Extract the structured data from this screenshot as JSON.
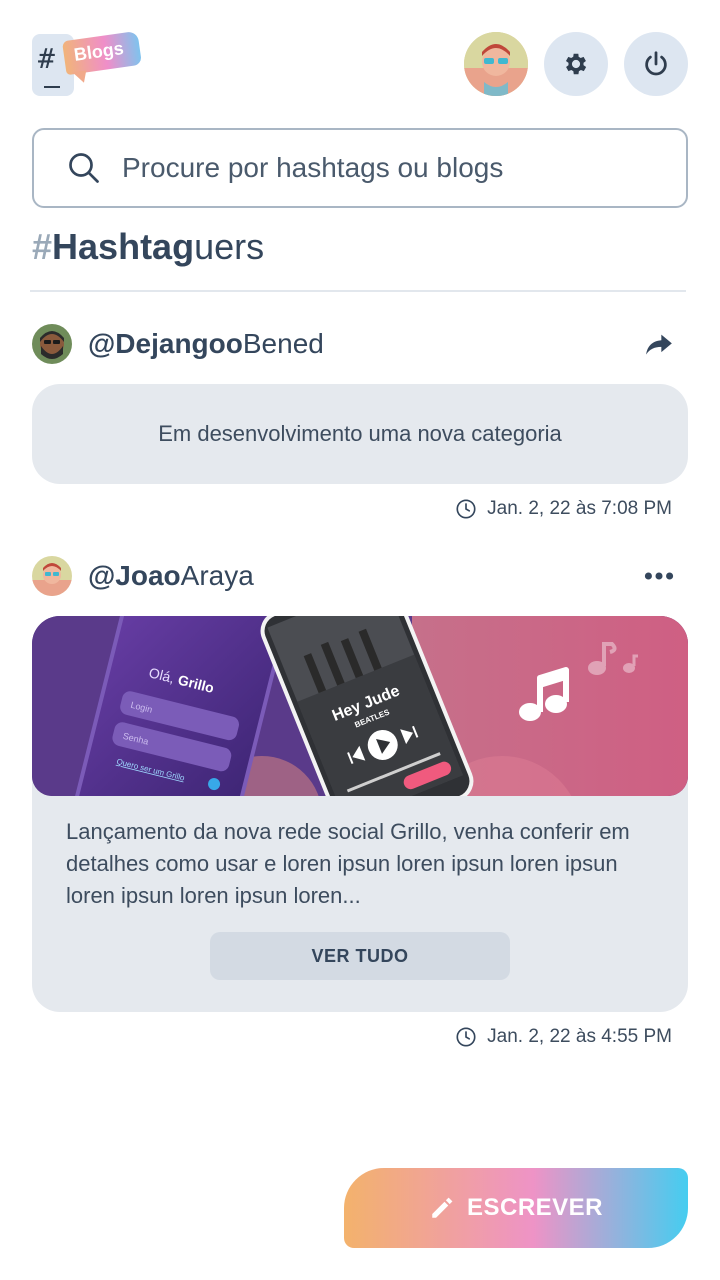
{
  "header": {
    "logo_hash": "#",
    "logo_tag": "Blogs"
  },
  "search": {
    "placeholder": "Procure por hashtags ou blogs"
  },
  "brand": {
    "hash": "#",
    "bold": "Hashtag",
    "rest": "uers"
  },
  "posts": [
    {
      "user_bold": "@Dejangoo",
      "user_rest": "Bened",
      "text": "Em desenvolvimento uma nova categoria",
      "time": "Jan. 2, 22 às 7:08 PM",
      "action_icon": "share-icon"
    },
    {
      "user_bold": "@Joao",
      "user_rest": "Araya",
      "text": "Lançamento da nova rede social Grillo, venha conferir em detalhes como usar e loren ipsun loren ipsun loren ipsun loren ipsun loren ipsun loren...",
      "button": "VER TUDO",
      "time": "Jan. 2, 22 às 4:55 PM",
      "action_icon": "more-icon",
      "media": {
        "greeting": "Olá,",
        "greeting_name": "Grillo",
        "login": "Login",
        "senha": "Senha",
        "link": "Quero ser um Grillo",
        "song": "Hey Jude",
        "artist": "BEATLES"
      }
    }
  ],
  "fab": {
    "label": "ESCREVER"
  },
  "colors": {
    "text": "#34465c",
    "card": "#e5e9ee",
    "accent_soft": "#dde6f1"
  }
}
